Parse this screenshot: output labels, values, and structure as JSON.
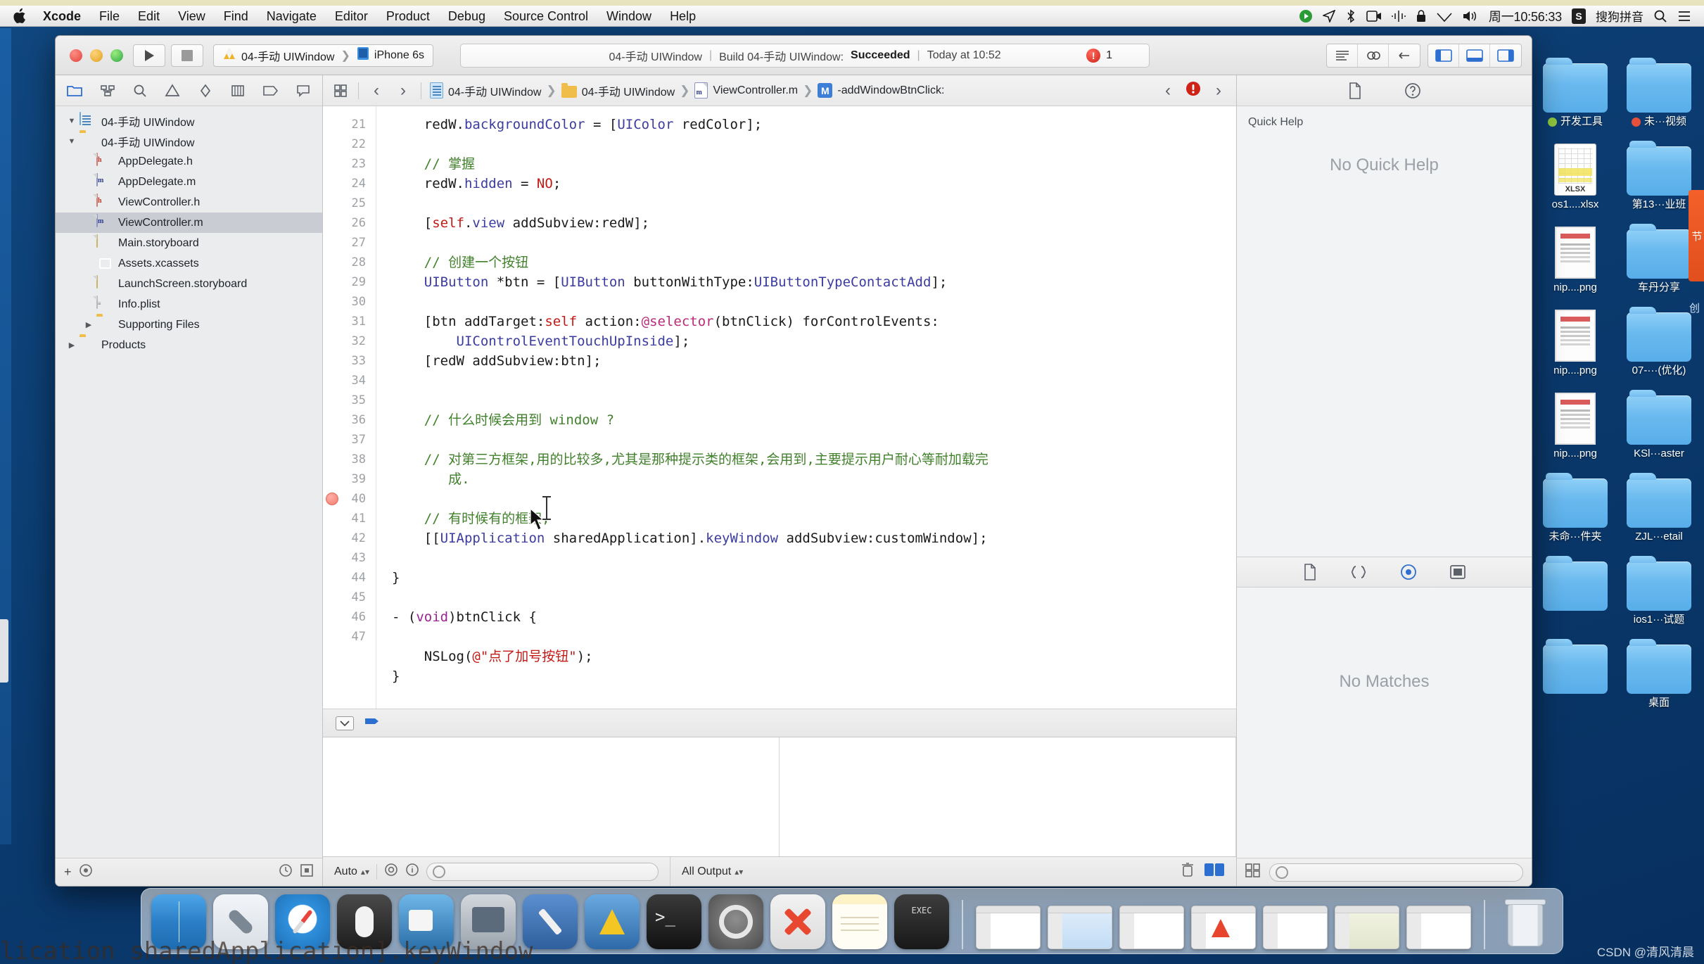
{
  "menubar": {
    "apple_icon": "apple-logo",
    "items": [
      "Xcode",
      "File",
      "Edit",
      "View",
      "Find",
      "Navigate",
      "Editor",
      "Product",
      "Debug",
      "Source Control",
      "Window",
      "Help"
    ],
    "status": {
      "clock": "周一10:56:33",
      "input_method": "搜狗拼音",
      "sogou_badge": "S",
      "icons": [
        "record-icon",
        "location-icon",
        "bluetooth-icon",
        "screen-record-icon",
        "vpn-icon",
        "lock-icon",
        "wifi-icon",
        "volume-icon",
        "search-icon",
        "control-center-icon"
      ]
    }
  },
  "xcode": {
    "toolbar": {
      "run_label": "▶",
      "stop_label": "■",
      "scheme_name": "04-手动 UIWindow",
      "scheme_sep": "❯",
      "destination": "iPhone 6s",
      "status_project": "04-手动 UIWindow",
      "status_build_prefix": "Build 04-手动 UIWindow:",
      "status_build_result": "Succeeded",
      "status_time": "Today at 10:52",
      "error_count": "1",
      "error_badge": "!"
    },
    "navigator": {
      "tabs": [
        "folder-icon",
        "source-control-icon",
        "search-icon",
        "warning-icon",
        "debug-icon",
        "breakpoint-icon",
        "test-icon",
        "report-icon"
      ],
      "items": [
        {
          "label": "04-手动 UIWindow",
          "icon": "project-icon",
          "indent": 0,
          "twisty": "▼",
          "selected": false
        },
        {
          "label": "04-手动 UIWindow",
          "icon": "folder-icon",
          "indent": 1,
          "twisty": "▼",
          "selected": false
        },
        {
          "label": "AppDelegate.h",
          "icon": "header-file-icon",
          "indent": 2,
          "twisty": "",
          "selected": false
        },
        {
          "label": "AppDelegate.m",
          "icon": "impl-file-icon",
          "indent": 2,
          "twisty": "",
          "selected": false
        },
        {
          "label": "ViewController.h",
          "icon": "header-file-icon",
          "indent": 2,
          "twisty": "",
          "selected": false
        },
        {
          "label": "ViewController.m",
          "icon": "impl-file-icon",
          "indent": 2,
          "twisty": "",
          "selected": true
        },
        {
          "label": "Main.storyboard",
          "icon": "storyboard-icon",
          "indent": 2,
          "twisty": "",
          "selected": false
        },
        {
          "label": "Assets.xcassets",
          "icon": "assets-icon",
          "indent": 2,
          "twisty": "",
          "selected": false
        },
        {
          "label": "LaunchScreen.storyboard",
          "icon": "storyboard-icon",
          "indent": 2,
          "twisty": "",
          "selected": false
        },
        {
          "label": "Info.plist",
          "icon": "plist-icon",
          "indent": 2,
          "twisty": "",
          "selected": false
        },
        {
          "label": "Supporting Files",
          "icon": "folder-icon",
          "indent": 2,
          "twisty": "▶",
          "selected": false
        },
        {
          "label": "Products",
          "icon": "folder-icon",
          "indent": 1,
          "twisty": "▶",
          "selected": false
        }
      ],
      "footer": {
        "add_label": "+",
        "filter_label": "⊙"
      }
    },
    "jump_bar": {
      "back_label": "‹",
      "forward_label": "›",
      "crumbs": [
        {
          "label": "04-手动 UIWindow",
          "icon": "project-icon"
        },
        {
          "label": "04-手动 UIWindow",
          "icon": "folder-icon"
        },
        {
          "label": "ViewController.m",
          "icon": "impl-file-icon"
        },
        {
          "label": "-addWindowBtnClick:",
          "icon": "method-badge",
          "badge": "M"
        }
      ],
      "issue_count": "",
      "prev_issue": "‹",
      "next_issue": "›"
    },
    "code": {
      "first_line": 21,
      "lines": [
        {
          "n": 21,
          "marker": false
        },
        {
          "n": 22,
          "marker": false
        },
        {
          "n": 23,
          "marker": false
        },
        {
          "n": 24,
          "marker": false
        },
        {
          "n": 25,
          "marker": false
        },
        {
          "n": 26,
          "marker": false
        },
        {
          "n": 27,
          "marker": false
        },
        {
          "n": 28,
          "marker": false
        },
        {
          "n": 29,
          "marker": false
        },
        {
          "n": 30,
          "marker": false
        },
        {
          "n": 31,
          "marker": false
        },
        {
          "n": 32,
          "marker": false
        },
        {
          "n": 33,
          "marker": false
        },
        {
          "n": 34,
          "marker": false
        },
        {
          "n": 35,
          "marker": false
        },
        {
          "n": 36,
          "marker": false
        },
        {
          "n": 37,
          "marker": false
        },
        {
          "n": 38,
          "marker": false
        },
        {
          "n": 39,
          "marker": false
        },
        {
          "n": 40,
          "marker": true
        },
        {
          "n": 41,
          "marker": false
        },
        {
          "n": 42,
          "marker": false
        },
        {
          "n": 43,
          "marker": false
        },
        {
          "n": 44,
          "marker": false
        },
        {
          "n": 45,
          "marker": false
        },
        {
          "n": 46,
          "marker": false
        },
        {
          "n": 47,
          "marker": false
        }
      ],
      "text": [
        "    redW.backgroundColor = [UIColor redColor];",
        "",
        "    // 掌握",
        "    redW.hidden = NO;",
        "",
        "    [self.view addSubview:redW];",
        "",
        "    // 创建一个按钮",
        "    UIButton *btn = [UIButton buttonWithType:UIButtonTypeContactAdd];",
        "",
        "    [btn addTarget:self action:@selector(btnClick) forControlEvents:",
        "        UIControlEventTouchUpInside];",
        "    [redW addSubview:btn];",
        "",
        "",
        "    // 什么时候会用到 window ?",
        "",
        "    // 对第三方框架,用的比较多,尤其是那种提示类的框架,会用到,主要提示用户耐心等耐加载完",
        "       成.",
        "",
        "    // 有时候有的框架,",
        "    [[UIApplication sharedApplication].keyWindow addSubview:customWindow];",
        "",
        "}",
        "",
        "- (void)btnClick {",
        "",
        "    NSLog(@\"点了加号按钮\");",
        "}"
      ]
    },
    "utilities": {
      "quick_help_title": "Quick Help",
      "quick_help_empty": "No Quick Help",
      "library_empty": "No Matches",
      "top_tabs": [
        "file-inspector-icon",
        "quick-help-icon"
      ],
      "bottom_tabs": [
        "file-template-library-icon",
        "code-snippet-library-icon",
        "object-library-icon",
        "media-library-icon"
      ]
    },
    "debug_bar": {
      "auto_label": "Auto",
      "output_label": "All Output",
      "filter_placeholder": "",
      "library_filter_placeholder": ""
    }
  },
  "desktop": {
    "icons": [
      {
        "name": "开发工具",
        "type": "folder",
        "dot": "green"
      },
      {
        "name": "未···视频",
        "type": "folder",
        "dot": "red"
      },
      {
        "name": "os1....xlsx",
        "type": "xlsx",
        "dot": ""
      },
      {
        "name": "第13···业班",
        "type": "folder",
        "dot": ""
      },
      {
        "name": "nip....png",
        "type": "png",
        "dot": ""
      },
      {
        "name": "车丹分享",
        "type": "folder",
        "dot": ""
      },
      {
        "name": "nip....png",
        "type": "png",
        "dot": ""
      },
      {
        "name": "07-···(优化)",
        "type": "folder",
        "dot": ""
      },
      {
        "name": "nip....png",
        "type": "png",
        "dot": ""
      },
      {
        "name": "KSl···aster",
        "type": "folder",
        "dot": ""
      },
      {
        "name": "未命···件夹",
        "type": "folder",
        "dot": ""
      },
      {
        "name": "ZJL···etail",
        "type": "folder",
        "dot": ""
      },
      {
        "name": "",
        "type": "folder",
        "dot": ""
      },
      {
        "name": "ios1···试题",
        "type": "folder",
        "dot": ""
      },
      {
        "name": "",
        "type": "folder",
        "dot": ""
      },
      {
        "name": "桌面",
        "type": "folder",
        "dot": ""
      }
    ],
    "orange_tab": "节",
    "right_strip": "创"
  },
  "dock": {
    "items": [
      {
        "name": "Finder",
        "class": "finder"
      },
      {
        "name": "Launchpad",
        "class": "launchpad"
      },
      {
        "name": "Safari",
        "class": "safari"
      },
      {
        "name": "Mouse",
        "class": "mouse"
      },
      {
        "name": "iMovie",
        "class": "imovie"
      },
      {
        "name": "Photos",
        "class": "photos"
      },
      {
        "name": "Dev Tool",
        "class": "devtool"
      },
      {
        "name": "Xcode",
        "class": "xcode-dk"
      },
      {
        "name": "Terminal",
        "class": "terminal"
      },
      {
        "name": "System Preferences",
        "class": "sysprefs"
      },
      {
        "name": "XMind",
        "class": "xmind"
      },
      {
        "name": "Notes",
        "class": "notes"
      },
      {
        "name": "Exec",
        "class": "exec"
      }
    ],
    "windows": [
      "win-thumb",
      "win-thumb blue",
      "win-thumb",
      "win-thumb pink",
      "win-thumb",
      "win-thumb olive",
      "win-thumb"
    ],
    "trash": "Trash"
  },
  "overlay": {
    "caption": "lication sharedApplication].keyWindow",
    "watermark": "CSDN @清风清晨"
  }
}
